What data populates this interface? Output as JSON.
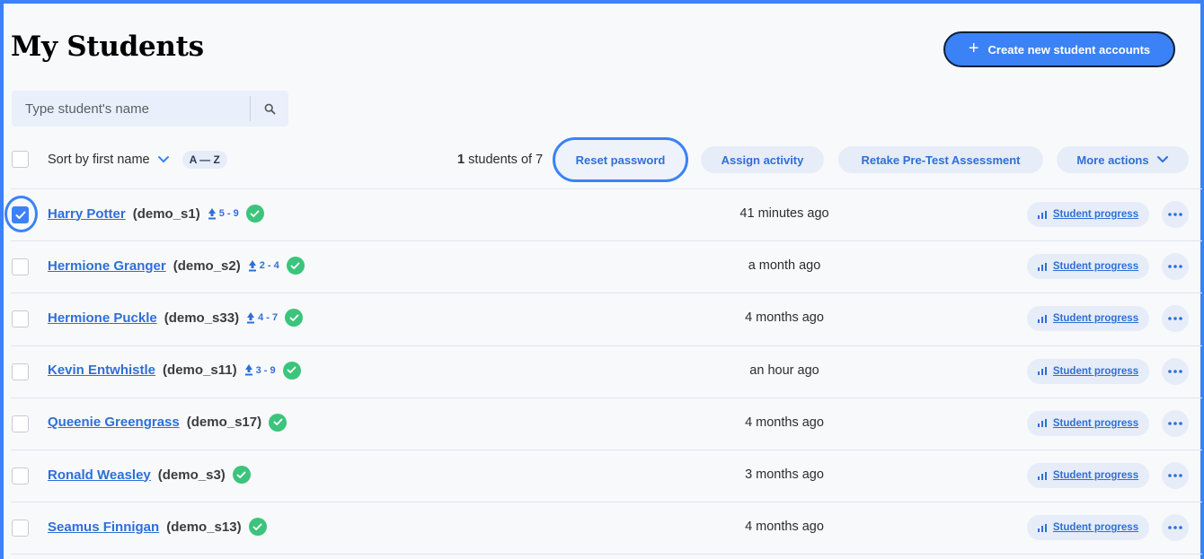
{
  "header": {
    "title": "My Students",
    "create_button_label": "Create new student accounts"
  },
  "search": {
    "placeholder": "Type student's name"
  },
  "toolbar": {
    "sort_label": "Sort by first name",
    "sort_order": "A — Z",
    "selected_count": "1",
    "count_suffix": " students of 7",
    "reset_password": "Reset password",
    "assign_activity": "Assign activity",
    "retake_assessment": "Retake Pre-Test Assessment",
    "more_actions": "More actions"
  },
  "colors": {
    "accent": "#3b82f6",
    "link": "#2f6fd6",
    "success": "#3cc47c",
    "pill_bg": "#e6edf8"
  },
  "progress_label": "Student progress",
  "students": [
    {
      "name": "Harry Potter",
      "username": "(demo_s1)",
      "level": "5 - 9",
      "time": "41 minutes ago",
      "checked": true
    },
    {
      "name": "Hermione Granger",
      "username": "(demo_s2)",
      "level": "2 - 4",
      "time": "a month ago",
      "checked": false
    },
    {
      "name": "Hermione Puckle",
      "username": "(demo_s33)",
      "level": "4 - 7",
      "time": "4 months ago",
      "checked": false
    },
    {
      "name": "Kevin Entwhistle",
      "username": "(demo_s11)",
      "level": "3 - 9",
      "time": "an hour ago",
      "checked": false
    },
    {
      "name": "Queenie Greengrass",
      "username": "(demo_s17)",
      "level": "",
      "time": "4 months ago",
      "checked": false
    },
    {
      "name": "Ronald Weasley",
      "username": "(demo_s3)",
      "level": "",
      "time": "3 months ago",
      "checked": false
    },
    {
      "name": "Seamus Finnigan",
      "username": "(demo_s13)",
      "level": "",
      "time": "4 months ago",
      "checked": false
    }
  ]
}
